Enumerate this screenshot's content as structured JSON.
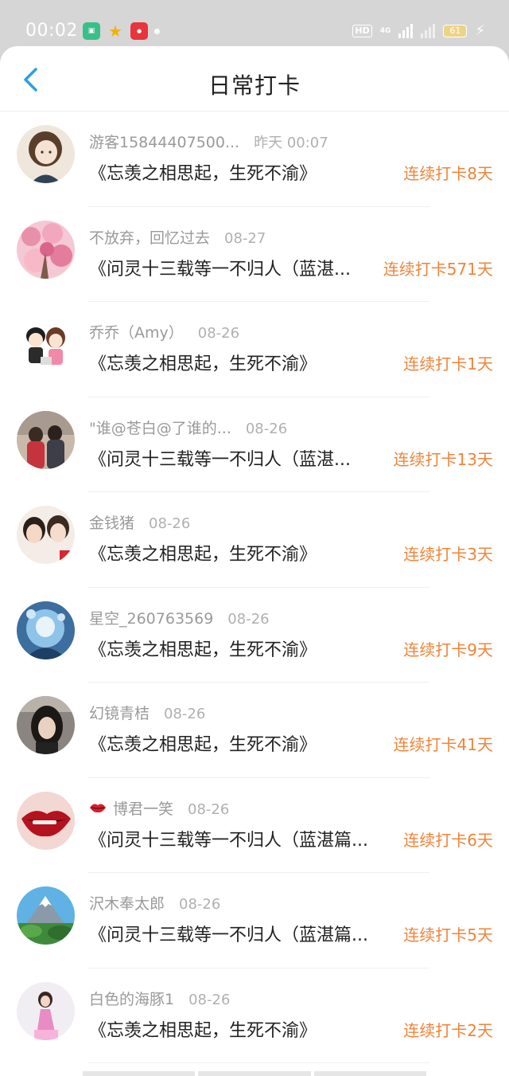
{
  "status_bar": {
    "time": "00:02",
    "hd_label": "HD",
    "network_label": "4G",
    "battery_level": "61"
  },
  "header": {
    "title": "日常打卡"
  },
  "colors": {
    "accent_blue": "#2c9ee8",
    "streak_orange": "#f0843a"
  },
  "entries": [
    {
      "user": "游客15844407500...",
      "time": "昨天 00:07",
      "course": "《忘羡之相思起，生死不渝》",
      "streak": "连续打卡8天",
      "avatar": "avatar-cartoon-girl-icon"
    },
    {
      "user": "不放弃，回忆过去",
      "time": "08-27",
      "course": "《问灵十三载等一不归人（蓝湛...",
      "streak": "连续打卡571天",
      "avatar": "avatar-pink-blossom-icon"
    },
    {
      "user": "乔乔（Amy）",
      "time": "08-26",
      "course": "《忘羡之相思起，生死不渝》",
      "streak": "连续打卡1天",
      "avatar": "avatar-cartoon-couple-icon"
    },
    {
      "user": "\"谁@苍白@了谁的...",
      "time": "08-26",
      "course": "《问灵十三载等一不归人（蓝湛...",
      "streak": "连续打卡13天",
      "avatar": "avatar-photo-kids-icon"
    },
    {
      "user": "金钱猪",
      "time": "08-26",
      "course": "《忘羡之相思起，生死不渝》",
      "streak": "连续打卡3天",
      "avatar": "avatar-photo-two-girls-icon"
    },
    {
      "user": "星空_260763569",
      "time": "08-26",
      "course": "《忘羡之相思起，生死不渝》",
      "streak": "连续打卡9天",
      "avatar": "avatar-anime-blue-icon"
    },
    {
      "user": "幻镜青桔",
      "time": "08-26",
      "course": "《忘羡之相思起，生死不渝》",
      "streak": "连续打卡41天",
      "avatar": "avatar-photo-dark-hair-icon"
    },
    {
      "user": "博君一笑",
      "time": "08-26",
      "course": "《问灵十三载等一不归人（蓝湛篇...",
      "streak": "连续打卡6天",
      "avatar": "avatar-red-lips-icon",
      "has_lips_icon": true
    },
    {
      "user": "沢木奉太郎",
      "time": "08-26",
      "course": "《问灵十三载等一不归人（蓝湛篇...",
      "streak": "连续打卡5天",
      "avatar": "avatar-mountain-landscape-icon"
    },
    {
      "user": "白色的海豚1",
      "time": "08-26",
      "course": "《忘羡之相思起，生死不渝》",
      "streak": "连续打卡2天",
      "avatar": "avatar-girl-pink-dress-icon"
    }
  ]
}
